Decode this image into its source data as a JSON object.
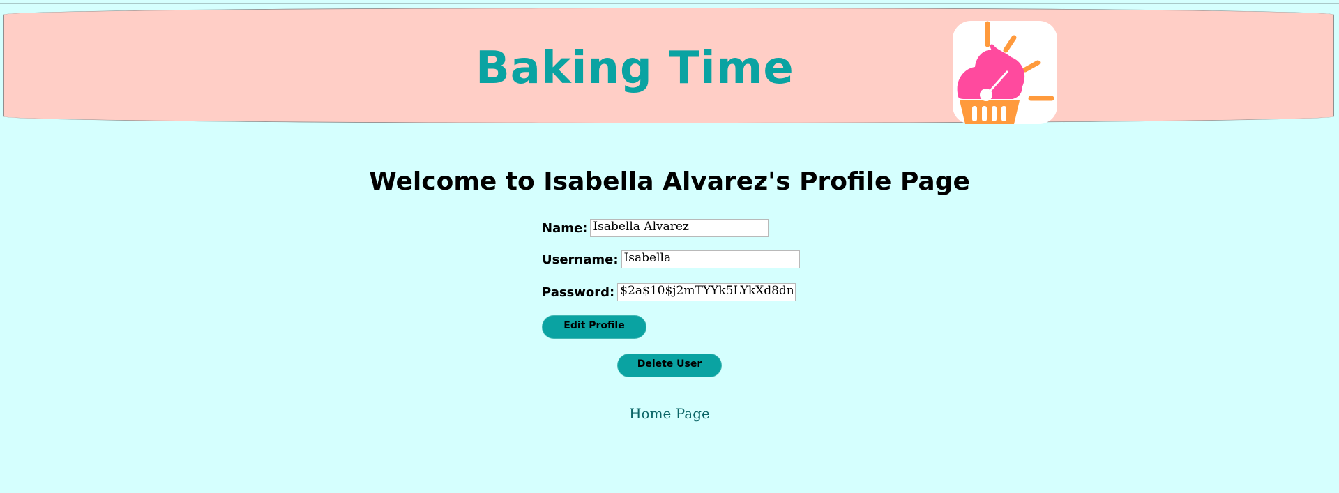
{
  "header": {
    "title": "Baking Time",
    "logo_icon": "cupcake-icon",
    "background": "#ffcec6",
    "title_color": "#0aa3a2"
  },
  "main": {
    "welcome": "Welcome to Isabella Alvarez's Profile Page",
    "form": {
      "name_label": "Name:",
      "name_value": "Isabella Alvarez",
      "username_label": "Username:",
      "username_value": "Isabella",
      "password_label": "Password:",
      "password_value": "$2a$10$j2mTYYk5LYkXd8dn"
    },
    "edit_button": "Edit Profile",
    "delete_button": "Delete User",
    "home_link": "Home Page"
  },
  "colors": {
    "page_background": "#d5fffe",
    "button": "#0aa3a2",
    "link": "#0b6566",
    "cupcake_frosting": "#ff4a9e",
    "cupcake_liner": "#ff9a3c"
  }
}
